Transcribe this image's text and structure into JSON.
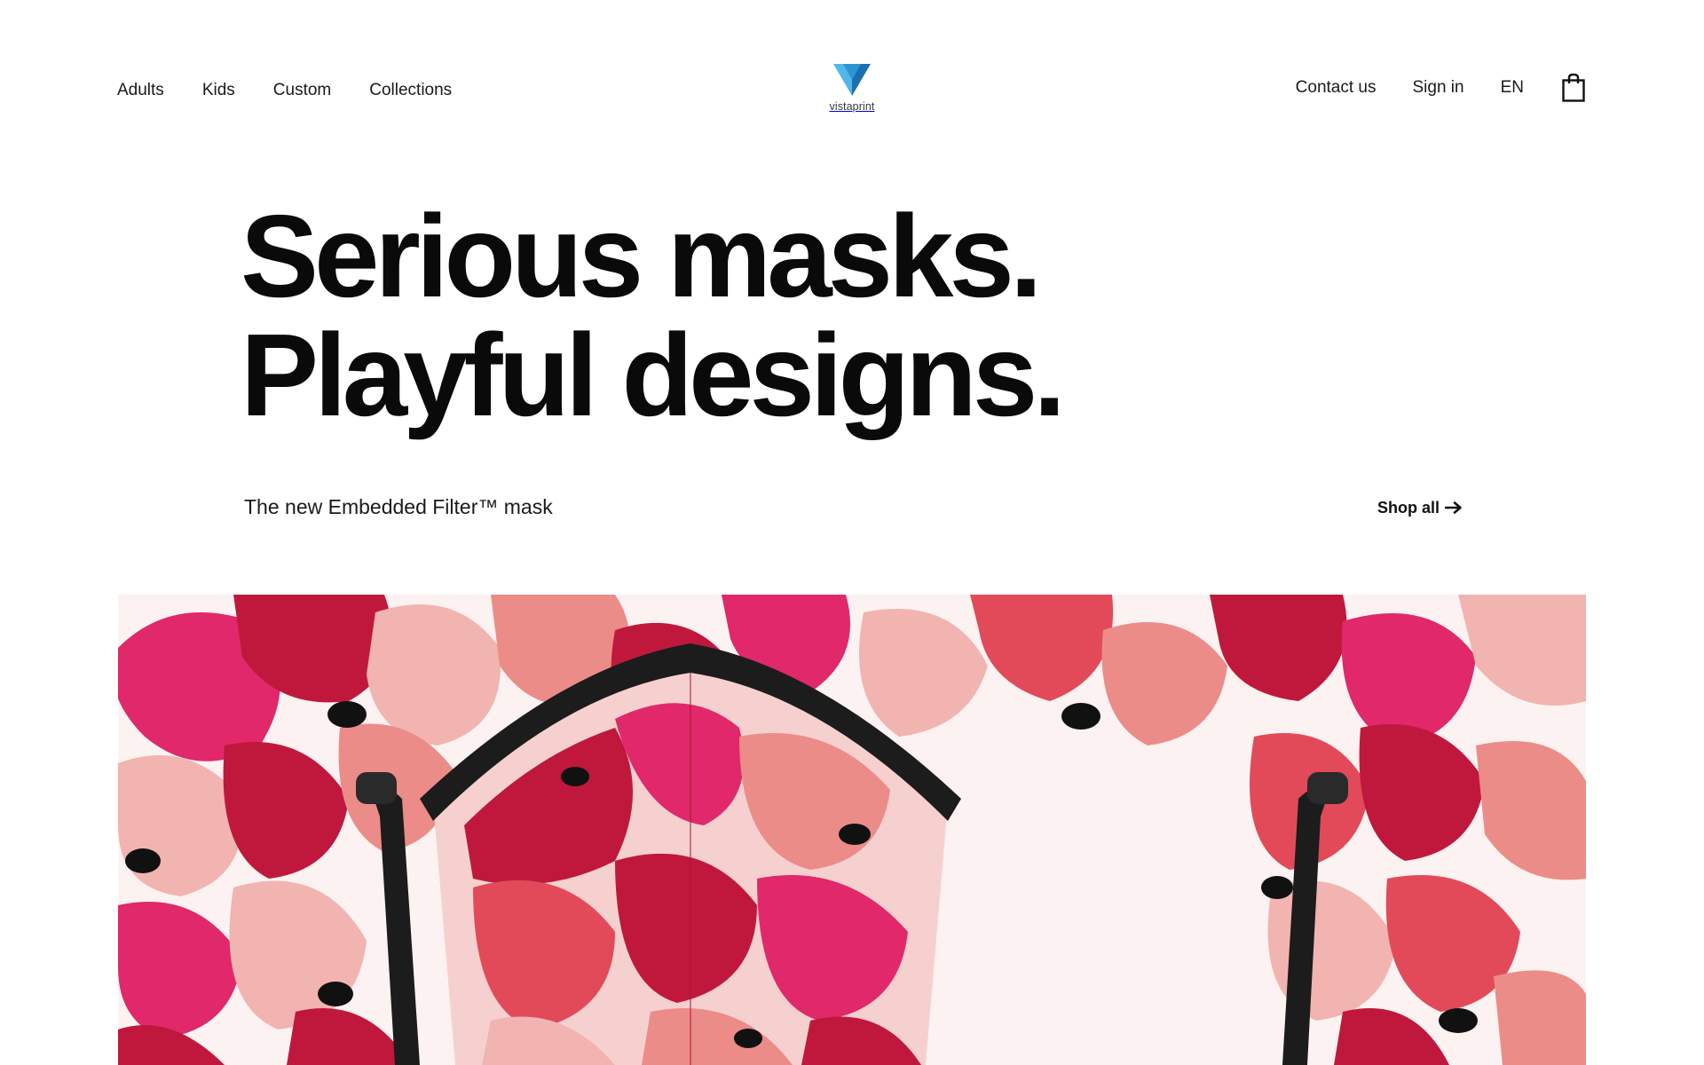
{
  "nav": {
    "left": [
      {
        "label": "Adults"
      },
      {
        "label": "Kids"
      },
      {
        "label": "Custom"
      },
      {
        "label": "Collections"
      }
    ],
    "right": {
      "contact": "Contact us",
      "signin": "Sign in",
      "language": "EN"
    },
    "cart_icon": "shopping-bag-icon"
  },
  "logo": {
    "text": "vistaprint",
    "colors": {
      "light": "#4fb8e8",
      "dark": "#1a6fb0"
    }
  },
  "hero": {
    "title_line1": "Serious masks.",
    "title_line2": "Playful designs.",
    "subtitle": "The new Embedded Filter™ mask",
    "cta": "Shop all",
    "cta_icon": "arrow-right-icon"
  },
  "colors": {
    "pattern_deep": "#c0183c",
    "pattern_magenta": "#e0286a",
    "pattern_coral": "#ec8c88",
    "pattern_blush": "#f2b4b0",
    "pattern_red": "#e24a5a",
    "mask_strap": "#1c1c1c"
  }
}
